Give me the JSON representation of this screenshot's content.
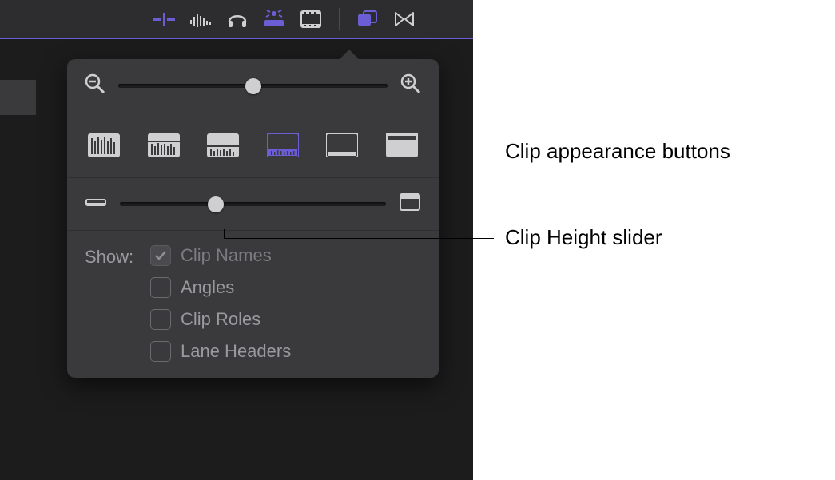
{
  "toolbar": {
    "icons": [
      "trim-icon",
      "waveform-icon",
      "headphones-icon",
      "clip-appearance-icon",
      "filmstrip-icon",
      "compound-clip-icon",
      "snap-icon"
    ]
  },
  "popover": {
    "zoom": {
      "value_percent": 50
    },
    "appearance": {
      "options": [
        {
          "id": "waveform-only",
          "active": false
        },
        {
          "id": "waveform-large",
          "active": false
        },
        {
          "id": "waveform-small",
          "active": false
        },
        {
          "id": "filmstrip-wave",
          "active": true
        },
        {
          "id": "filmstrip-only",
          "active": false
        },
        {
          "id": "filmstrip-large",
          "active": false
        }
      ]
    },
    "height": {
      "value_percent": 36
    },
    "show": {
      "label": "Show:",
      "items": [
        {
          "label": "Clip Names",
          "checked": true,
          "disabled": true
        },
        {
          "label": "Angles",
          "checked": false,
          "disabled": false
        },
        {
          "label": "Clip Roles",
          "checked": false,
          "disabled": false
        },
        {
          "label": "Lane Headers",
          "checked": false,
          "disabled": false
        }
      ]
    }
  },
  "annotations": {
    "appearance_label": "Clip appearance buttons",
    "height_label": "Clip Height slider"
  }
}
